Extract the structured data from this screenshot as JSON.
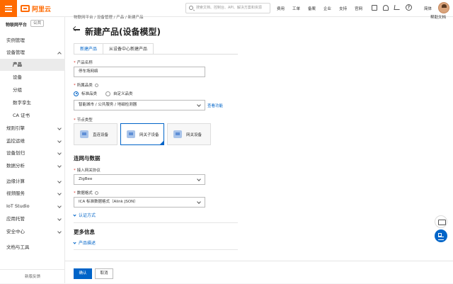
{
  "topbar": {
    "logo_text": "阿里云",
    "search_placeholder": "搜索文档、控制台、API、解决方案和资源",
    "nav": [
      "费用",
      "工单",
      "备案",
      "企业",
      "支持",
      "官网"
    ],
    "lang": "简体"
  },
  "sidebar": {
    "header": "物联网平台",
    "tag": "公共",
    "items": [
      {
        "label": "实例管理"
      },
      {
        "label": "设备管理"
      },
      {
        "label": "产品"
      },
      {
        "label": "设备"
      },
      {
        "label": "分组"
      },
      {
        "label": "数字孪生"
      },
      {
        "label": "CA 证书"
      },
      {
        "label": "规则引擎"
      },
      {
        "label": "监控运维"
      },
      {
        "label": "设备划归"
      },
      {
        "label": "数据分析"
      },
      {
        "label": "边缘计算"
      },
      {
        "label": "视频服务"
      },
      {
        "label": "IoT Studio"
      },
      {
        "label": "应用托管"
      },
      {
        "label": "安全中心"
      },
      {
        "label": "文档与工具"
      }
    ],
    "feedback": "新版反馈"
  },
  "main": {
    "breadcrumb": "物联网平台 / 设备管理 / 产品 / 新建产品",
    "help": "帮助文档",
    "title": "新建产品(设备模型)",
    "tabs": [
      "新建产品",
      "从设备中心新建产品"
    ],
    "form": {
      "product_name_label": "产品名称",
      "product_name_value": "停车场网络",
      "category_label": "所属品类",
      "category_standard": "标准品类",
      "category_custom": "自定义品类",
      "category_value": "智能城市 / 公共服务 / 地磁检测器",
      "view_feature_link": "查看功能",
      "node_type_label": "节点类型",
      "node_types": [
        "直连设备",
        "网关子设备",
        "网关设备"
      ],
      "section_connect": "连网与数据",
      "protocol_label": "接入网关协议",
      "protocol_value": "ZigBee",
      "data_format_label": "数据格式",
      "data_format_value": "ICA 标准数据格式（Alink JSON）",
      "auth_expander": "认证方式",
      "section_more": "更多信息",
      "desc_expander": "产品描述"
    },
    "footer": {
      "confirm": "确认",
      "cancel": "取消"
    }
  }
}
